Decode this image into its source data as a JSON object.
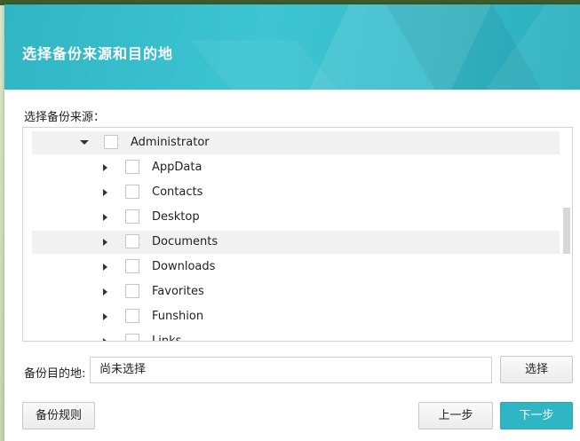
{
  "dialog": {
    "title": "选择备份来源和目的地"
  },
  "source": {
    "label": "选择备份来源：",
    "tree": [
      {
        "label": "Administrator",
        "level": 0,
        "expanded": true,
        "checked": false,
        "highlighted": true
      },
      {
        "label": "AppData",
        "level": 1,
        "expanded": false,
        "checked": false,
        "highlighted": false
      },
      {
        "label": "Contacts",
        "level": 1,
        "expanded": false,
        "checked": false,
        "highlighted": false
      },
      {
        "label": "Desktop",
        "level": 1,
        "expanded": false,
        "checked": false,
        "highlighted": false
      },
      {
        "label": "Documents",
        "level": 1,
        "expanded": false,
        "checked": false,
        "highlighted": true
      },
      {
        "label": "Downloads",
        "level": 1,
        "expanded": false,
        "checked": false,
        "highlighted": false
      },
      {
        "label": "Favorites",
        "level": 1,
        "expanded": false,
        "checked": false,
        "highlighted": false
      },
      {
        "label": "Funshion",
        "level": 1,
        "expanded": false,
        "checked": false,
        "highlighted": false
      },
      {
        "label": "Links",
        "level": 1,
        "expanded": false,
        "checked": false,
        "highlighted": false
      }
    ]
  },
  "destination": {
    "label": "备份目的地:",
    "value": "尚未选择",
    "select_button": "选择"
  },
  "footer": {
    "rules_button": "备份规则",
    "prev_button": "上一步",
    "next_button": "下一步"
  },
  "colors": {
    "accent": "#2fb6c4"
  }
}
